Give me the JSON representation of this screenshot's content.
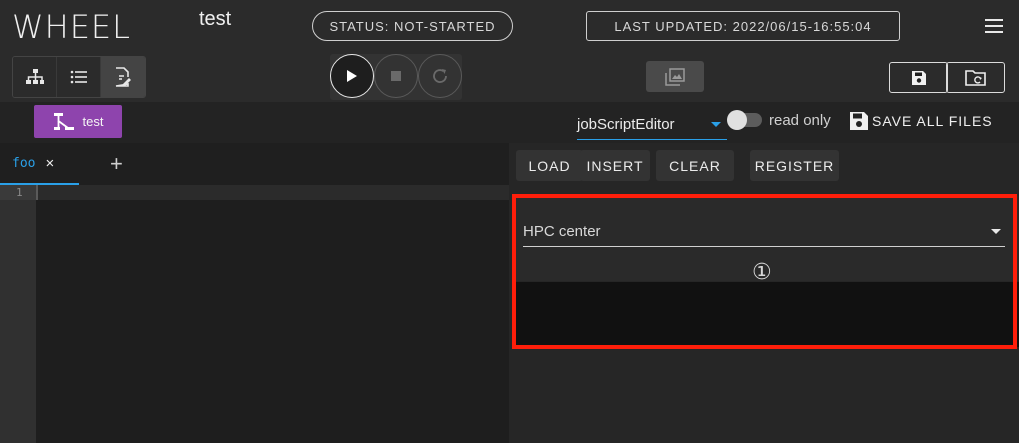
{
  "header": {
    "app_title": "WHEEL",
    "project_name": "test",
    "status": "STATUS: NOT-STARTED",
    "last_updated": "LAST UPDATED: 2022/06/15-16:55:04"
  },
  "breadcrumb": {
    "label": "test"
  },
  "editor": {
    "mode": "jobScriptEditor",
    "read_only_label": "read only",
    "save_all_label": "SAVE ALL FILES",
    "tab_name": "foo",
    "tab_close": "×",
    "add_tab": "+",
    "line_number": "1"
  },
  "panel": {
    "load": "LOAD",
    "insert": "INSERT",
    "clear": "CLEAR",
    "register": "REGISTER",
    "hpc_select": "HPC center",
    "callout": "①"
  },
  "colors": {
    "accent": "#2aa0e8",
    "breadcrumb": "#8e44ad",
    "highlight": "#ff1e0a"
  }
}
